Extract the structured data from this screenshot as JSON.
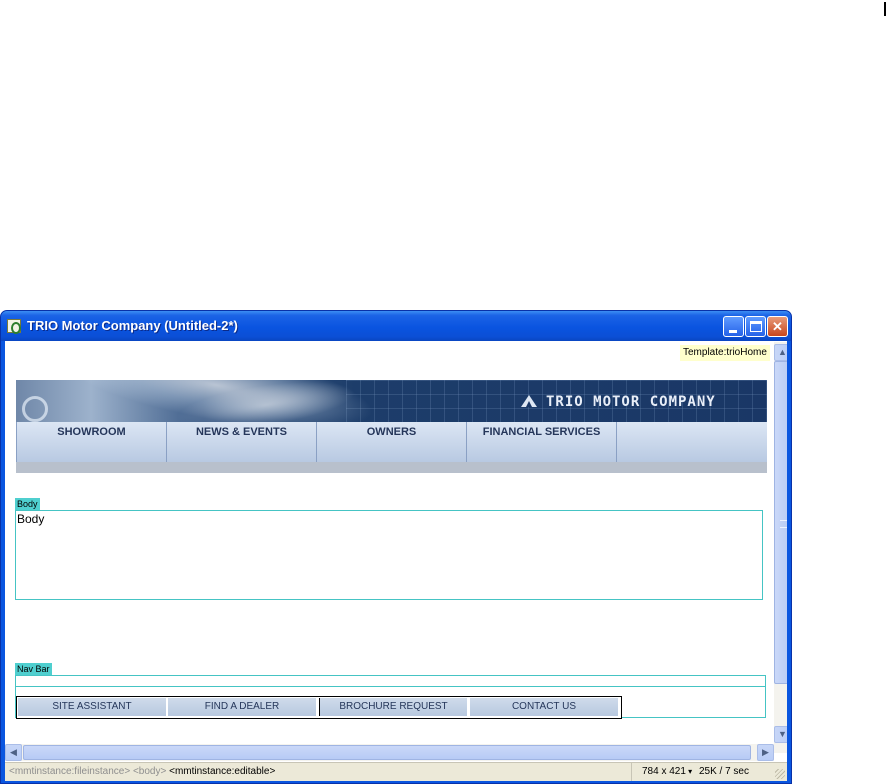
{
  "window": {
    "title": "TRIO Motor Company (Untitled-2*)"
  },
  "template_tag": "Template:trioHome",
  "site": {
    "brand": "TRIO MOTOR COMPANY",
    "main_nav": [
      "SHOWROOM",
      "NEWS & EVENTS",
      "OWNERS",
      "FINANCIAL SERVICES",
      ""
    ],
    "footer_nav": [
      "SITE ASSISTANT",
      "FIND A DEALER",
      "BROCHURE REQUEST",
      "CONTACT US"
    ]
  },
  "regions": {
    "body_label": "Body",
    "body_text": "Body",
    "navbar_label": "Nav Bar"
  },
  "status": {
    "tag_path_1": "<mmtinstance:fileinstance>",
    "tag_path_2": "<body>",
    "tag_path_3": "<mmtinstance:editable>",
    "window_size": "784 x 421",
    "file_stats": "25K / 7 sec"
  },
  "colors": {
    "titlebar": "#0a54e0",
    "region_outline": "#45c4c4",
    "nav_background": "#c8d5ea",
    "header_background": "#1d3d6a"
  },
  "icons": {
    "app": "dreamweaver-document-icon",
    "minimize": "minimize-icon",
    "maximize": "maximize-icon",
    "close": "close-icon"
  }
}
